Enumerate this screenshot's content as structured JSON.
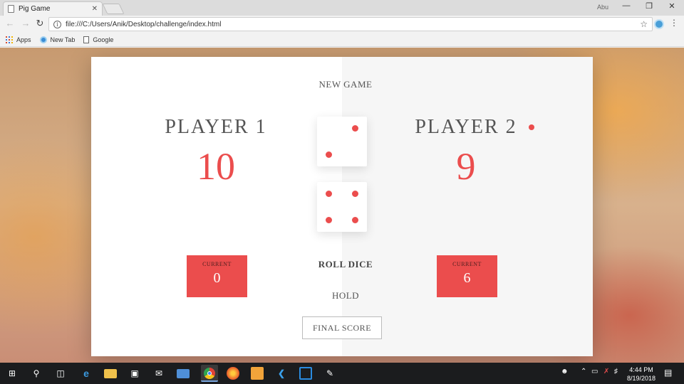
{
  "browser": {
    "tab_title": "Pig Game",
    "tab_close": "✕",
    "window_user": "Abu",
    "url": "file:///C:/Users/Anik/Desktop/challenge/index.html",
    "bookmarks": [
      "Apps",
      "New Tab",
      "Google"
    ]
  },
  "game": {
    "new_game_label": "NEW GAME",
    "roll_label": "ROLL DICE",
    "hold_label": "HOLD",
    "final_score_label": "FINAL SCORE",
    "active_player": 2,
    "dice_values": [
      2,
      4
    ],
    "players": [
      {
        "name": "PLAYER 1",
        "score": "10",
        "current_label": "CURRENT",
        "current": "0"
      },
      {
        "name": "PLAYER 2",
        "score": "9",
        "current_label": "CURRENT",
        "current": "6"
      }
    ],
    "colors": {
      "accent": "#eb4d4d"
    }
  },
  "taskbar": {
    "time": "4:44 PM",
    "date": "8/19/2018"
  }
}
